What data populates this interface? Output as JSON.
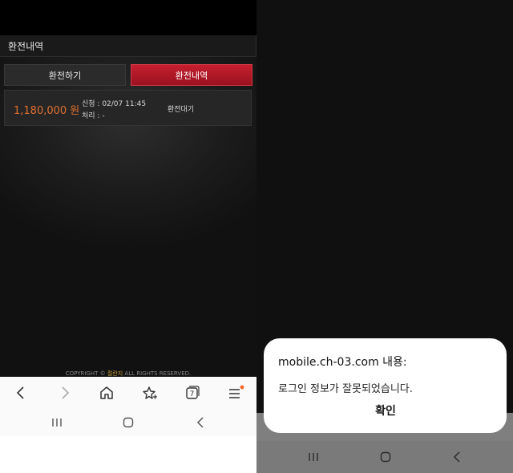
{
  "left": {
    "section_title": "환전내역",
    "tabs": [
      {
        "label": "환전하기",
        "active": false
      },
      {
        "label": "환전내역",
        "active": true
      }
    ],
    "record": {
      "amount": "1,180,000 원",
      "request": "신청 : 02/07 11:45",
      "process": "처리 : -",
      "status": "환전대기"
    },
    "copyright": {
      "prefix": "COPYRIGHT ©",
      "brand": "절란지",
      "suffix": "ALL RIGHTS RESERVED."
    },
    "browser_nav": {
      "icons": [
        "back-icon",
        "forward-icon",
        "home-icon",
        "bookmark-star-icon",
        "tabs-icon",
        "menu-icon"
      ],
      "tab_count": "7"
    },
    "system_nav": [
      "recent-apps-icon",
      "home-circle-icon",
      "back-chevron-icon"
    ]
  },
  "right": {
    "dialog": {
      "title": "mobile.ch-03.com 내용:",
      "message": "로그인 정보가 잘못되었습니다.",
      "confirm_label": "확인"
    },
    "system_nav": [
      "recent-apps-icon",
      "home-circle-icon",
      "back-chevron-icon"
    ]
  },
  "colors": {
    "active_tab": "#b5192a",
    "amount": "#e0702f",
    "brand": "#c9a23a",
    "notification_dot": "#f26522"
  }
}
